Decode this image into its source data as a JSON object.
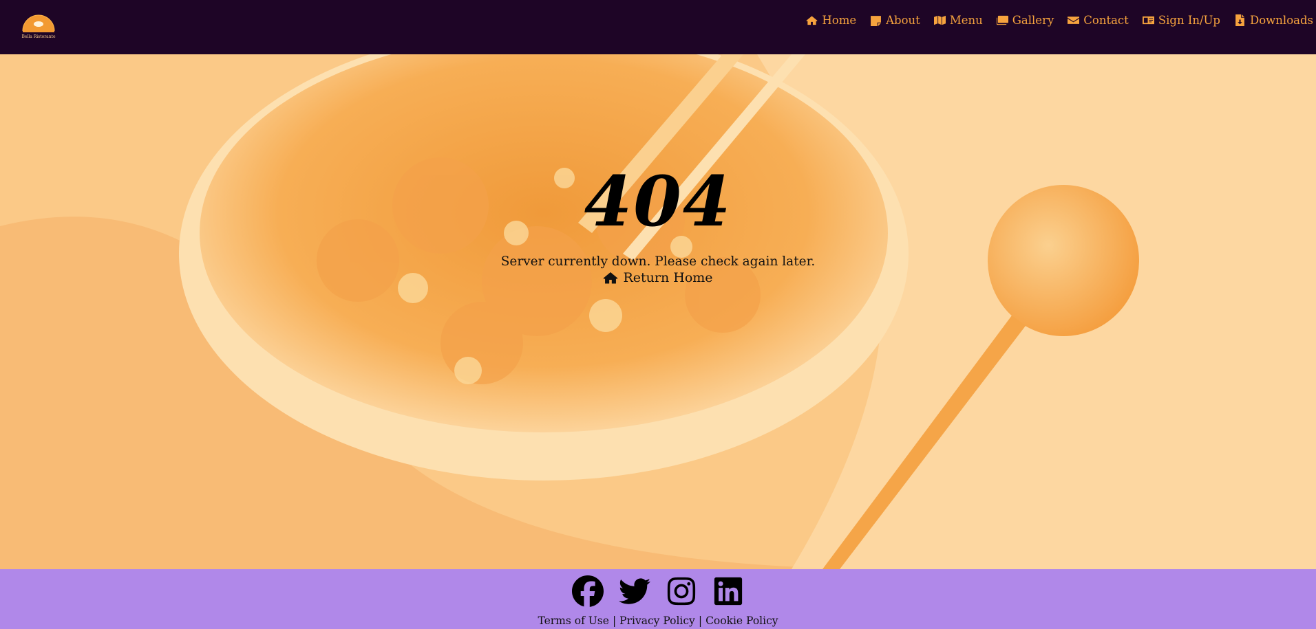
{
  "brand": {
    "logo_text": "Bella Ristorante",
    "accent": "#f6a33e",
    "nav_bg": "#1e0526"
  },
  "nav": {
    "items": [
      {
        "label": "Home",
        "icon": "home-icon"
      },
      {
        "label": "About",
        "icon": "sticky-note-icon"
      },
      {
        "label": "Menu",
        "icon": "map-icon"
      },
      {
        "label": "Gallery",
        "icon": "images-icon"
      },
      {
        "label": "Contact",
        "icon": "envelope-icon"
      },
      {
        "label": "Sign In/Up",
        "icon": "id-card-icon"
      },
      {
        "label": "Downloads",
        "icon": "file-download-icon"
      }
    ]
  },
  "hero": {
    "code": "404",
    "message": "Server currently down. Please check again later.",
    "return_label": "Return Home"
  },
  "footer": {
    "bg": "#b088e9",
    "socials": [
      "facebook-icon",
      "twitter-icon",
      "instagram-icon",
      "linkedin-icon"
    ],
    "links": [
      "Terms of Use",
      "Privacy Policy",
      "Cookie Policy"
    ]
  }
}
